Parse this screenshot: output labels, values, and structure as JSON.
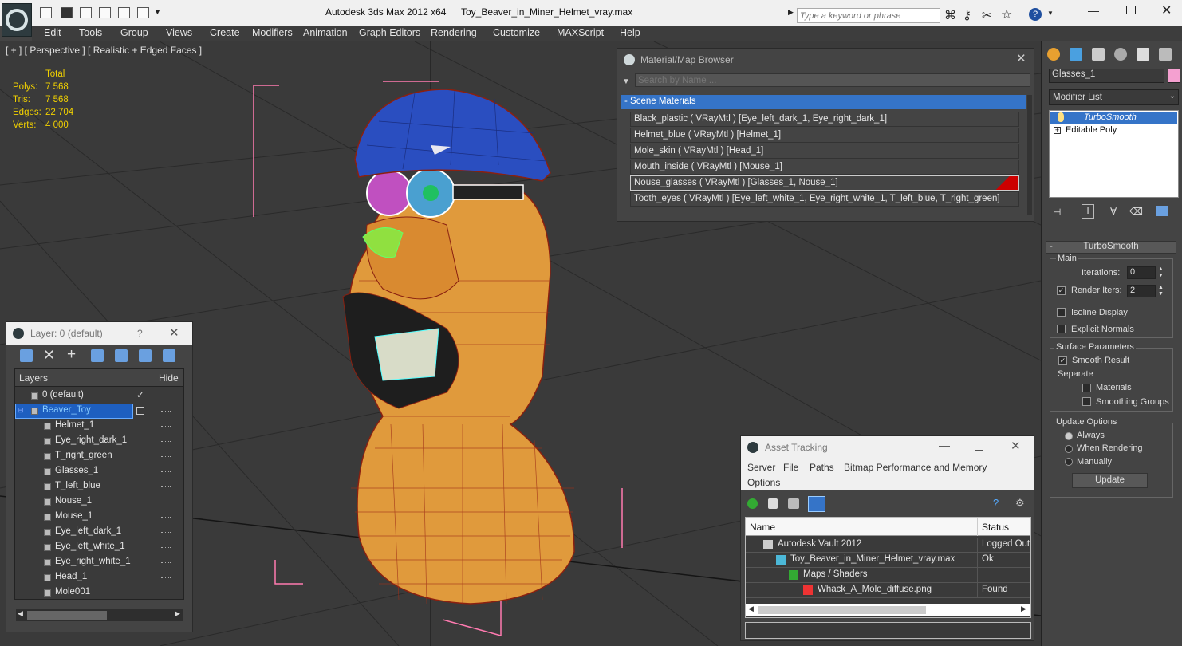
{
  "app": {
    "title": "Autodesk 3ds Max  2012 x64",
    "file": "Toy_Beaver_in_Miner_Helmet_vray.max"
  },
  "search": {
    "placeholder": "Type a keyword or phrase"
  },
  "menu": [
    "Edit",
    "Tools",
    "Group",
    "Views",
    "Create",
    "Modifiers",
    "Animation",
    "Graph Editors",
    "Rendering",
    "Customize",
    "MAXScript",
    "Help"
  ],
  "viewport": {
    "label": "[ + ] [ Perspective ] [ Realistic + Edged Faces ]",
    "stats": {
      "header": "Total",
      "polys_label": "Polys:",
      "polys": "7 568",
      "tris_label": "Tris:",
      "tris": "7 568",
      "edges_label": "Edges:",
      "edges": "22 704",
      "verts_label": "Verts:",
      "verts": "4 000"
    }
  },
  "material_browser": {
    "title": "Material/Map Browser",
    "search_placeholder": "Search by Name ...",
    "group": "- Scene Materials",
    "items": [
      "Black_plastic  ( VRayMtl )  [Eye_left_dark_1, Eye_right_dark_1]",
      "Helmet_blue  ( VRayMtl )  [Helmet_1]",
      "Mole_skin  ( VRayMtl )  [Head_1]",
      "Mouth_inside  ( VRayMtl )  [Mouse_1]",
      "Nouse_glasses  ( VRayMtl )  [Glasses_1, Nouse_1]",
      "Tooth_eyes  ( VRayMtl )  [Eye_left_white_1, Eye_right_white_1, T_left_blue, T_right_green]"
    ]
  },
  "layer": {
    "title": "Layer: 0 (default)",
    "help": "?",
    "col_layers": "Layers",
    "col_hide": "Hide",
    "rows": [
      "0 (default)",
      "Beaver_Toy",
      "Helmet_1",
      "Eye_right_dark_1",
      "T_right_green",
      "Glasses_1",
      "T_left_blue",
      "Nouse_1",
      "Mouse_1",
      "Eye_left_dark_1",
      "Eye_left_white_1",
      "Eye_right_white_1",
      "Head_1",
      "Mole001"
    ]
  },
  "command_panel": {
    "object_name": "Glasses_1",
    "modifier_list": "Modifier List",
    "stack": [
      "TurboSmooth",
      "Editable Poly"
    ],
    "rollout": "TurboSmooth",
    "main": "Main",
    "iterations_label": "Iterations:",
    "iterations": "0",
    "render_iters_label": "Render Iters:",
    "render_iters": "2",
    "isoline": "Isoline Display",
    "explicit": "Explicit Normals",
    "surface": "Surface Parameters",
    "smooth_result": "Smooth Result",
    "separate": "Separate",
    "materials": "Materials",
    "smoothing_groups": "Smoothing Groups",
    "update_options": "Update Options",
    "always": "Always",
    "when_rendering": "When Rendering",
    "manually": "Manually",
    "update": "Update"
  },
  "asset": {
    "title": "Asset Tracking",
    "menu": [
      "Server",
      "File",
      "Paths",
      "Bitmap Performance and Memory"
    ],
    "options": "Options",
    "col_name": "Name",
    "col_status": "Status",
    "rows": [
      {
        "name": "Autodesk Vault 2012",
        "status": "Logged Out"
      },
      {
        "name": "Toy_Beaver_in_Miner_Helmet_vray.max",
        "status": "Ok"
      },
      {
        "name": "Maps / Shaders",
        "status": ""
      },
      {
        "name": "Whack_A_Mole_diffuse.png",
        "status": "Found"
      }
    ]
  },
  "colors": {
    "accent": "#3574c8",
    "stat_yellow": "#f0d000",
    "body_orange": "#e09a3c",
    "helmet_blue": "#2a4ec0"
  }
}
